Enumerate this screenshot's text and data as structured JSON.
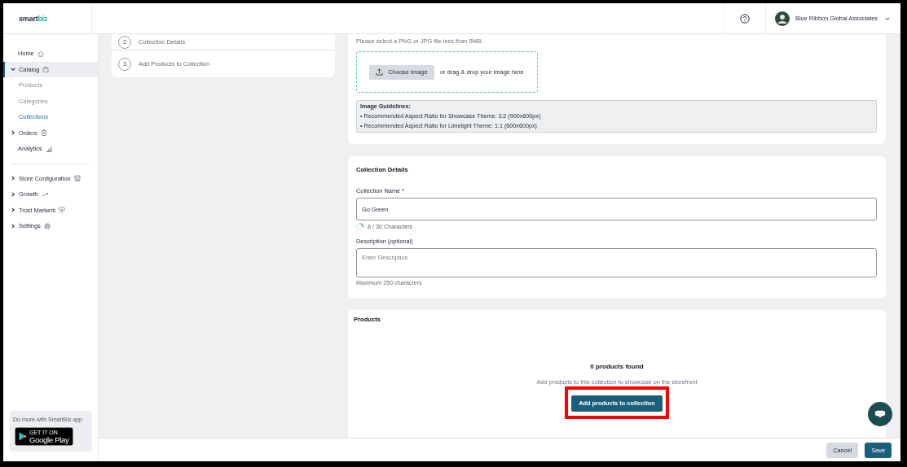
{
  "header": {
    "logo": {
      "parts": [
        "smart",
        "biz"
      ]
    },
    "account": {
      "name": "Blue Ribbon Global Associates"
    }
  },
  "sidebar": {
    "sections": [
      {
        "items": [
          {
            "label": "Home",
            "kind": "link",
            "selected": false
          },
          {
            "label": "Catalog",
            "kind": "group",
            "expanded": true,
            "selected": true,
            "children": [
              {
                "label": "Products",
                "selected": false
              },
              {
                "label": "Categories",
                "selected": false
              },
              {
                "label": "Collections",
                "selected": true
              }
            ]
          },
          {
            "label": "Orders",
            "kind": "group",
            "expanded": false,
            "selected": false
          },
          {
            "label": "Analytics",
            "kind": "link",
            "selected": false
          }
        ]
      },
      {
        "items": [
          {
            "label": "Store Configuration",
            "kind": "group",
            "expanded": false,
            "selected": false
          },
          {
            "label": "Growth",
            "kind": "group",
            "expanded": false,
            "selected": false
          },
          {
            "label": "Trust Markers",
            "kind": "group",
            "expanded": false,
            "selected": false
          },
          {
            "label": "Settings",
            "kind": "group",
            "expanded": false,
            "selected": false
          }
        ]
      }
    ],
    "promo": {
      "text": "Do more with SmartBiz app",
      "badge": {
        "small_text": "GET IT ON",
        "large_text": "Google Play"
      }
    }
  },
  "stepper": {
    "steps": [
      {
        "number": "2",
        "label": "Collection Details"
      },
      {
        "number": "3",
        "label": "Add Products to Collection"
      }
    ]
  },
  "image_card": {
    "hint": "Please select a PNG or JPG file less than 5MB.",
    "upload_button": "Choose Image",
    "drop_text": "or drag & drop your image here",
    "guidelines": {
      "title": "Image Guidelines:",
      "lines": [
        "• Recommended Aspect Ratio for Showcase Theme: 3:2 (900x600px)",
        "• Recommended Aspect Ratio for Limelight Theme: 1:1 (600x600px)"
      ]
    }
  },
  "details_card": {
    "title": "Collection Details",
    "name_field": {
      "label": "Collection Name *",
      "value": "Go Green",
      "counter": "8 / 30 Characters"
    },
    "description_field": {
      "label": "Description (optional)",
      "placeholder": "Enter Description",
      "hint": "Maximum 250 characters"
    }
  },
  "products_card": {
    "title": "Products",
    "empty_title": "0 products found",
    "empty_text": "Add products to this collection to showcase on the storefront",
    "add_button": {
      "label": "Add products to collection",
      "highlighted": true
    }
  },
  "footer": {
    "buttons": [
      {
        "label": "Cancel",
        "kind": "secondary"
      },
      {
        "label": "Save",
        "kind": "primary"
      }
    ]
  }
}
